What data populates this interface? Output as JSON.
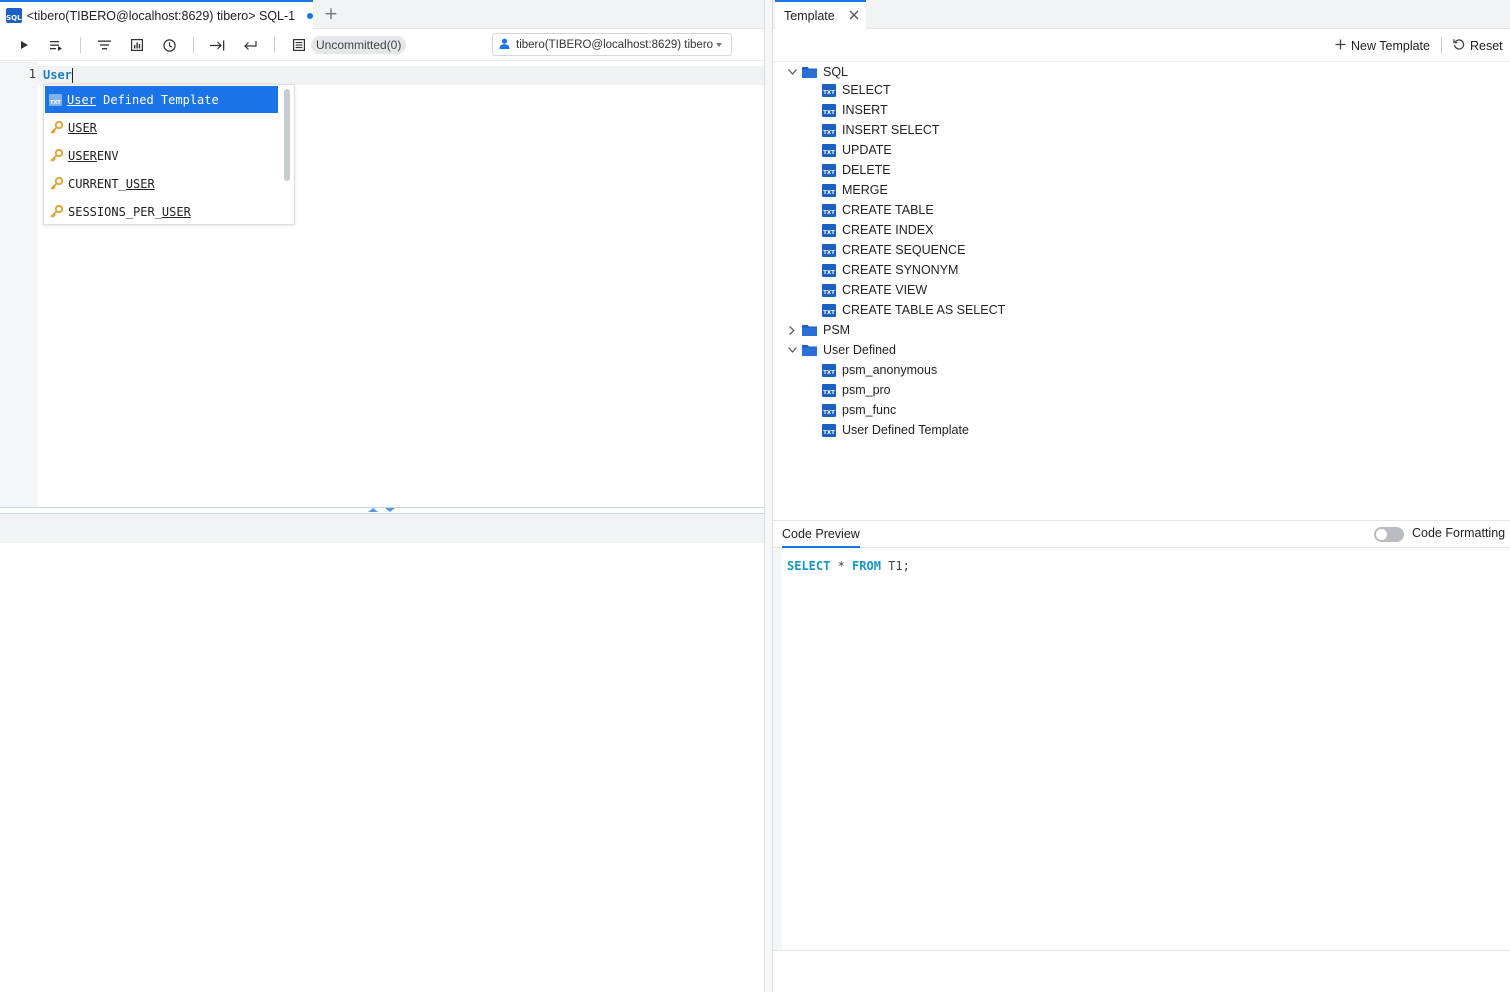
{
  "editor": {
    "tab": {
      "icon": "sql-file-icon",
      "icon_text": "SQL",
      "label": "<tibero(TIBERO@localhost:8629) tibero> SQL-1",
      "add_icon": "plus-icon",
      "add_glyph": "+"
    },
    "toolbar": {
      "icons": [
        "run-icon",
        "run-script-icon",
        "sort-icon",
        "explain-plan-icon",
        "history-icon",
        "indent-icon",
        "undo-icon",
        "transaction-icon"
      ],
      "uncommitted_label": "Uncommitted(0)",
      "connection_label": "tibero(TIBERO@localhost:8629) tibero",
      "connection_icon": "user-icon"
    },
    "line_number": "1",
    "code_text": "User",
    "autocomplete": {
      "items": [
        {
          "match": "User",
          "rest": " Defined Template",
          "icon": "template-txt-icon",
          "icon_text": "TXT",
          "selected": true
        },
        {
          "prefix": "",
          "match": "USER",
          "rest": "",
          "icon": "keyword-key-icon"
        },
        {
          "prefix": "",
          "match": "USER",
          "rest": "ENV",
          "icon": "keyword-key-icon"
        },
        {
          "prefix": "CURRENT_",
          "match": "USER",
          "rest": "",
          "icon": "keyword-key-icon"
        },
        {
          "prefix": "SESSIONS_PER_",
          "match": "USER",
          "rest": "",
          "icon": "keyword-key-icon"
        }
      ]
    }
  },
  "template_panel": {
    "tab_label": "Template",
    "close_icon": "close-icon",
    "new_template_label": "New Template",
    "new_template_icon": "plus-icon",
    "reset_label": "Reset",
    "reset_icon": "reset-icon",
    "file_icon_text": "TXT",
    "tree": {
      "sql": {
        "label": "SQL",
        "expanded": true,
        "items": [
          "SELECT",
          "INSERT",
          "INSERT SELECT",
          "UPDATE",
          "DELETE",
          "MERGE",
          "CREATE TABLE",
          "CREATE INDEX",
          "CREATE SEQUENCE",
          "CREATE SYNONYM",
          "CREATE VIEW",
          "CREATE TABLE AS SELECT"
        ]
      },
      "psm": {
        "label": "PSM",
        "expanded": false
      },
      "user_defined": {
        "label": "User Defined",
        "expanded": true,
        "items": [
          "psm_anonymous",
          "psm_pro",
          "psm_func",
          "User Defined Template"
        ]
      }
    }
  },
  "code_preview": {
    "tab_label": "Code Preview",
    "formatting_label": "Code Formatting",
    "formatting_enabled": false,
    "code": {
      "kw1": "SELECT",
      "mid": " * ",
      "kw2": "FROM",
      "rest": " T1;"
    }
  },
  "colors": {
    "accent": "#1a73e8",
    "keyword": "#1597c8",
    "file_icon": "#1b5fc7",
    "key_icon": "#e0a030"
  }
}
